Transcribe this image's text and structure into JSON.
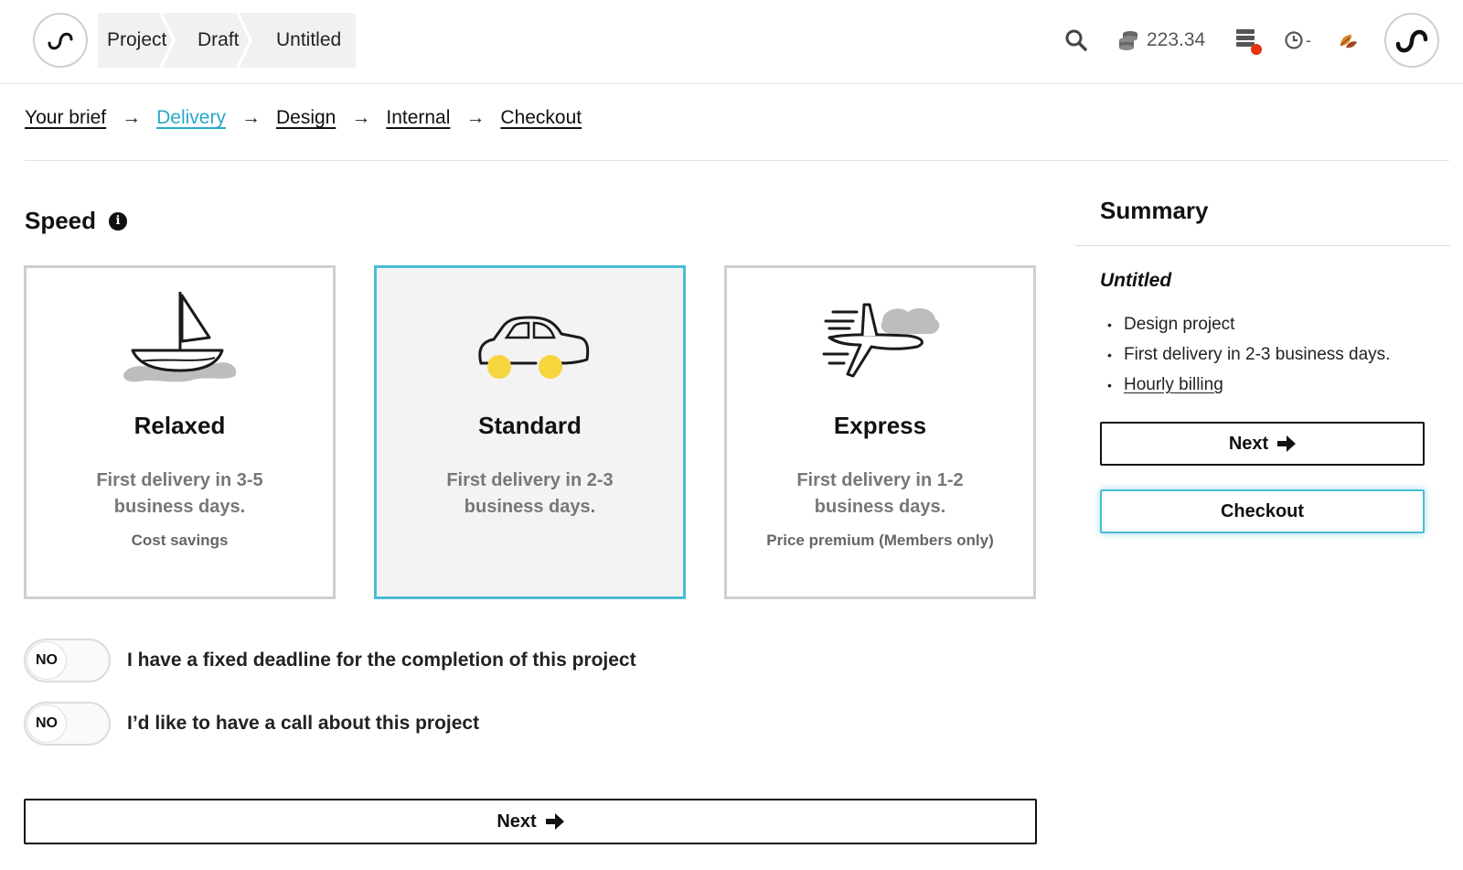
{
  "header": {
    "breadcrumbs": [
      "Project",
      "Draft",
      "Untitled"
    ],
    "balance": "223.34",
    "clock_value": "-",
    "notification_color": "#e63312"
  },
  "steps": [
    {
      "label": "Your brief",
      "active": false
    },
    {
      "label": "Delivery",
      "active": true
    },
    {
      "label": "Design",
      "active": false
    },
    {
      "label": "Internal",
      "active": false
    },
    {
      "label": "Checkout",
      "active": false
    }
  ],
  "speed": {
    "title": "Speed",
    "options": [
      {
        "title": "Relaxed",
        "desc": "First delivery in 3-5 business days.",
        "note": "Cost savings",
        "icon": "sailboat-icon",
        "selected": false
      },
      {
        "title": "Standard",
        "desc": "First delivery in 2-3 business days.",
        "note": "",
        "icon": "car-icon",
        "selected": true
      },
      {
        "title": "Express",
        "desc": "First delivery in 1-2 business days.",
        "note": "Price premium (Members only)",
        "icon": "airplane-icon",
        "selected": false
      }
    ]
  },
  "toggles": [
    {
      "state": "NO",
      "label": "I have a fixed deadline for the completion of this project"
    },
    {
      "state": "NO",
      "label": "I’d like to have a call about this project"
    }
  ],
  "buttons": {
    "next": "Next",
    "checkout": "Checkout"
  },
  "summary": {
    "title": "Summary",
    "project_name": "Untitled",
    "items": [
      "Design project",
      "First delivery in 2-3 business days.",
      "Hourly billing"
    ]
  },
  "colors": {
    "accent": "#4bbbd6",
    "link_active": "#2aa9c8",
    "wheel_yellow": "#f5d63d"
  }
}
